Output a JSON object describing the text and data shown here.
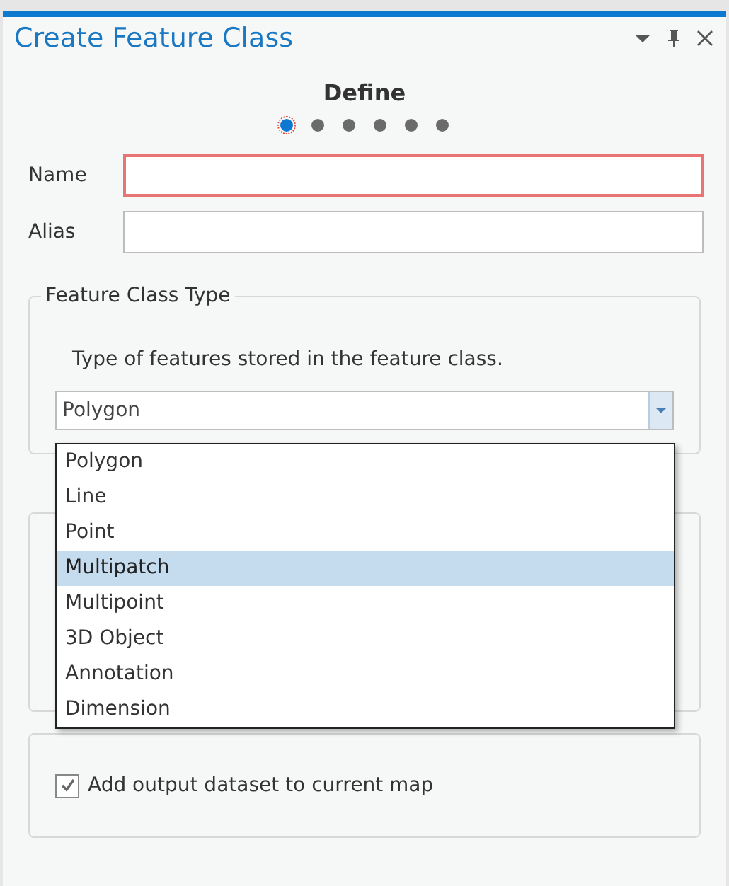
{
  "pane": {
    "title": "Create Feature Class"
  },
  "wizard": {
    "step_title": "Define",
    "steps": [
      {
        "selected": true
      },
      {
        "selected": false
      },
      {
        "selected": false
      },
      {
        "selected": false
      },
      {
        "selected": false
      },
      {
        "selected": false
      }
    ]
  },
  "fields": [
    {
      "label": "Name",
      "invalid": true
    },
    {
      "label": "Alias",
      "invalid": false
    }
  ],
  "feature_class_type": {
    "legend": "Feature Class Type",
    "description": "Type of features stored in the feature class.",
    "value": "Polygon",
    "options": [
      {
        "label": "Polygon",
        "highlighted": false
      },
      {
        "label": "Line",
        "highlighted": false
      },
      {
        "label": "Point",
        "highlighted": false
      },
      {
        "label": "Multipatch",
        "highlighted": true
      },
      {
        "label": "Multipoint",
        "highlighted": false
      },
      {
        "label": "3D Object",
        "highlighted": false
      },
      {
        "label": "Annotation",
        "highlighted": false
      },
      {
        "label": "Dimension",
        "highlighted": false
      }
    ]
  },
  "add_to_map": {
    "label": "Add output dataset to current map",
    "checked": true
  }
}
